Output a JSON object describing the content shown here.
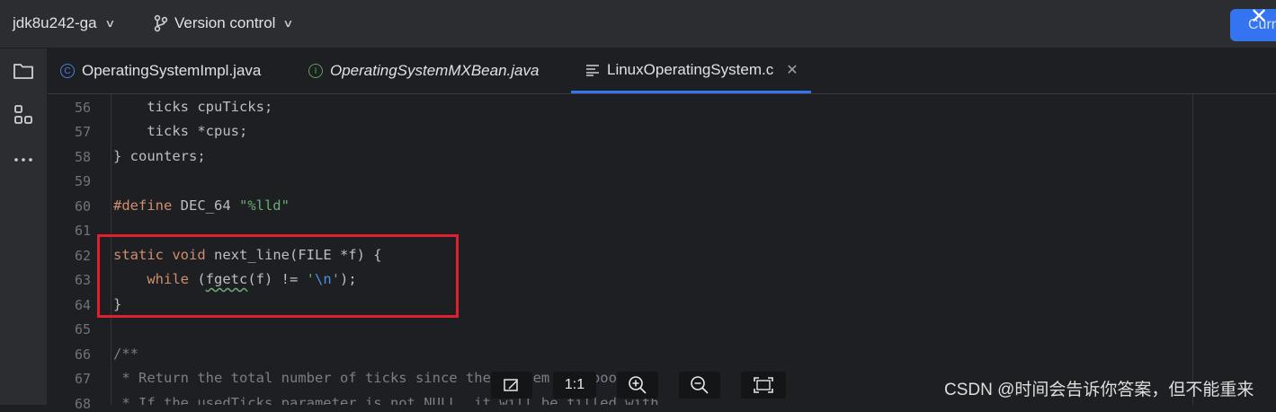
{
  "topbar": {
    "project": "jdk8u242-ga",
    "vcs": "Version control",
    "current_button": "Curr"
  },
  "tabs": [
    {
      "label": "OperatingSystemImpl.java",
      "icon": "C",
      "icon_color": "#4d7bdd"
    },
    {
      "label": "OperatingSystemMXBean.java",
      "icon": "I",
      "icon_color": "#5aa257"
    },
    {
      "label": "LinuxOperatingSystem.c",
      "icon": "text-file-icon",
      "active": true
    }
  ],
  "gutter": [
    "56",
    "57",
    "58",
    "59",
    "60",
    "61",
    "62",
    "63",
    "64",
    "65",
    "66",
    "67",
    "68"
  ],
  "code": {
    "l56": "    ticks cpuTicks;",
    "l57": "    ticks *cpus;",
    "l58": "} counters;",
    "l60_kw": "#define",
    "l60_rest": " DEC_64 ",
    "l60_str": "\"%lld\"",
    "l62_kw1": "static",
    "l62_kw2": "void",
    "l62_rest": " next_line(FILE *f) {",
    "l63_kw": "while",
    "l63_a": " (",
    "l63_fn": "fgetc",
    "l63_b": "(f) != ",
    "l63_q1": "'",
    "l63_esc": "\\n",
    "l63_q2": "'",
    "l63_c": ");",
    "l64": "}",
    "l66": "/**",
    "l67": " * Return the total number of ticks since the system was booted.",
    "l68": " * If the usedTicks parameter is not NULL, it will be filled with"
  },
  "viewer": {
    "zoom_reset": "1:1"
  },
  "watermark": "CSDN @时间会告诉你答案，但不能重来"
}
